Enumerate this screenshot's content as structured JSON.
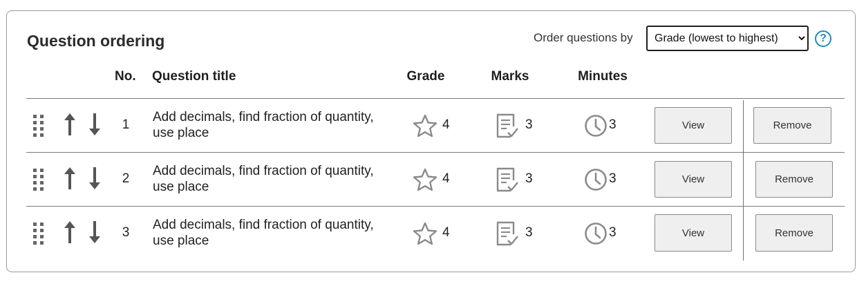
{
  "panel": {
    "title": "Question ordering",
    "order_label": "Order questions by",
    "order_select": {
      "selected": "Grade (lowest to highest)",
      "options": [
        "Grade (lowest to highest)"
      ]
    },
    "help_symbol": "?"
  },
  "columns": {
    "no": "No.",
    "title": "Question title",
    "grade": "Grade",
    "marks": "Marks",
    "minutes": "Minutes"
  },
  "rows": [
    {
      "no": "1",
      "title": "Add decimals, find fraction of quantity, use place",
      "grade": "4",
      "marks": "3",
      "minutes": "3",
      "view_label": "View",
      "remove_label": "Remove"
    },
    {
      "no": "2",
      "title": "Add decimals, find fraction of quantity, use place",
      "grade": "4",
      "marks": "3",
      "minutes": "3",
      "view_label": "View",
      "remove_label": "Remove"
    },
    {
      "no": "3",
      "title": "Add decimals, find fraction of quantity, use place",
      "grade": "4",
      "marks": "3",
      "minutes": "3",
      "view_label": "View",
      "remove_label": "Remove"
    }
  ],
  "icons": {
    "drag": "drag-handle-icon",
    "up": "arrow-up-icon",
    "down": "arrow-down-icon",
    "grade": "star-icon",
    "marks": "checklist-icon",
    "minutes": "clock-icon",
    "help": "help-icon"
  },
  "colors": {
    "help_accent": "#1d8fb5",
    "icon_gray": "#8a8a8a",
    "arrow_gray": "#555555",
    "button_bg": "#efefef"
  }
}
